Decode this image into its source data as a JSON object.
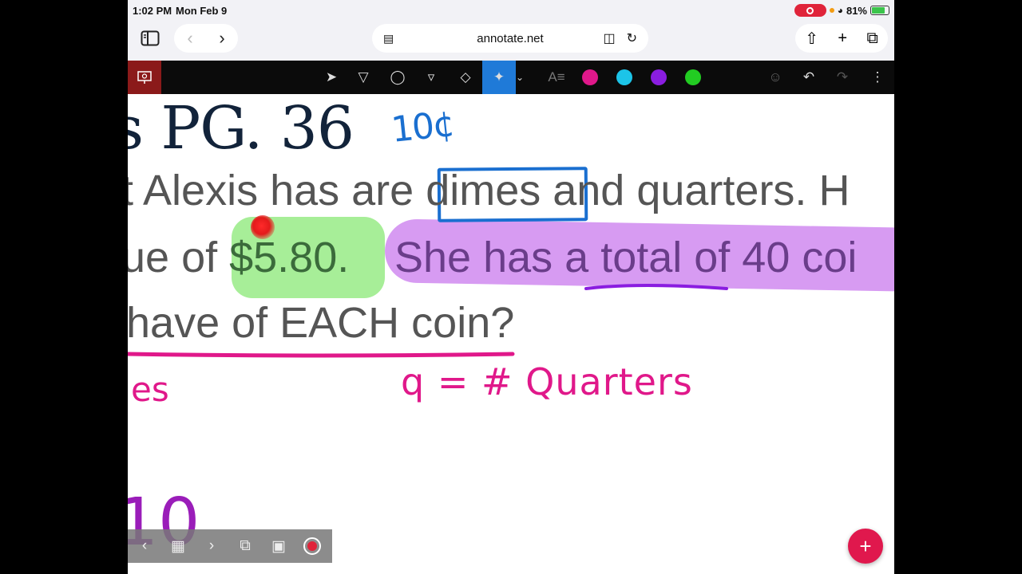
{
  "status": {
    "time": "1:02 PM",
    "date": "Mon Feb 9",
    "battery": "81%"
  },
  "browser": {
    "url": "annotate.net"
  },
  "toolbar": {
    "colors": [
      "#e0188a",
      "#1cc4e8",
      "#8a1de0",
      "#22cc22"
    ],
    "active_tool": "laser-pointer"
  },
  "content": {
    "title": "s PG. 36",
    "line1": "t Alexis has are dimes and quarters. H",
    "line2_prefix": "ue of ",
    "price": "$5.80.",
    "line2_rest": " She has a total of 40 coi",
    "line3": "have of EACH coin?"
  },
  "ink": {
    "blue_note": "10¢",
    "pink_left": "es",
    "pink_var": "q = # Quarters",
    "purple_num": "10"
  }
}
